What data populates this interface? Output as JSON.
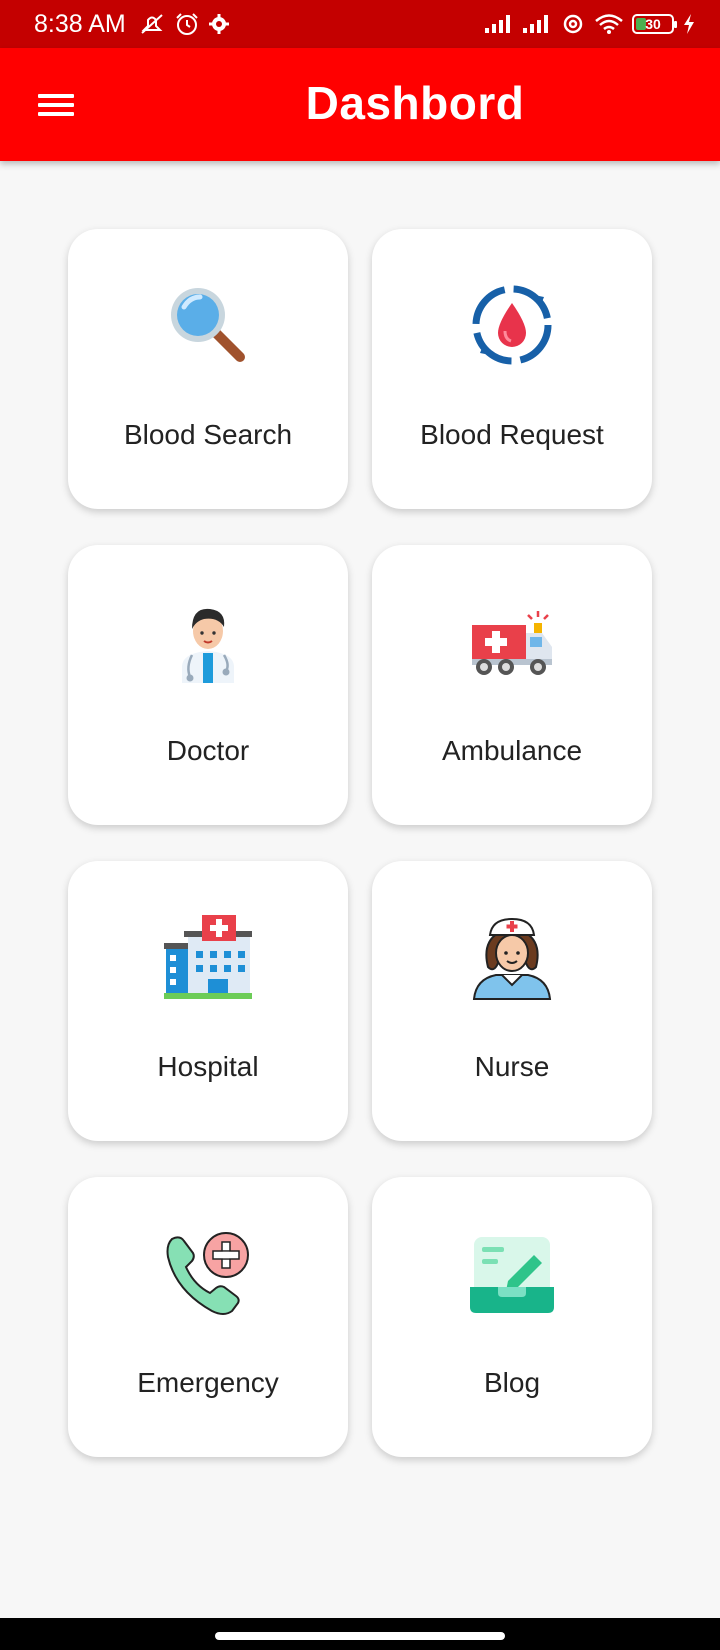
{
  "status_bar": {
    "time": "8:38 AM",
    "battery_level": "30",
    "icons": [
      "mute-icon",
      "alarm-icon",
      "settings-icon",
      "signal-icon",
      "signal-icon",
      "hotspot-icon",
      "wifi-icon",
      "battery-icon",
      "charging-icon"
    ]
  },
  "app_bar": {
    "title": "Dashbord",
    "menu_icon": "hamburger-menu-icon"
  },
  "colors": {
    "status_bar": "#c40000",
    "app_bar": "#ff0000",
    "background": "#f7f7f7",
    "card": "#ffffff"
  },
  "cards": [
    {
      "label": "Blood Search",
      "icon": "magnifier-icon"
    },
    {
      "label": "Blood Request",
      "icon": "blood-drop-cycle-icon"
    },
    {
      "label": "Doctor",
      "icon": "doctor-icon"
    },
    {
      "label": "Ambulance",
      "icon": "ambulance-icon"
    },
    {
      "label": "Hospital",
      "icon": "hospital-icon"
    },
    {
      "label": "Nurse",
      "icon": "nurse-icon"
    },
    {
      "label": "Emergency",
      "icon": "emergency-phone-icon"
    },
    {
      "label": "Blog",
      "icon": "blog-icon"
    }
  ]
}
